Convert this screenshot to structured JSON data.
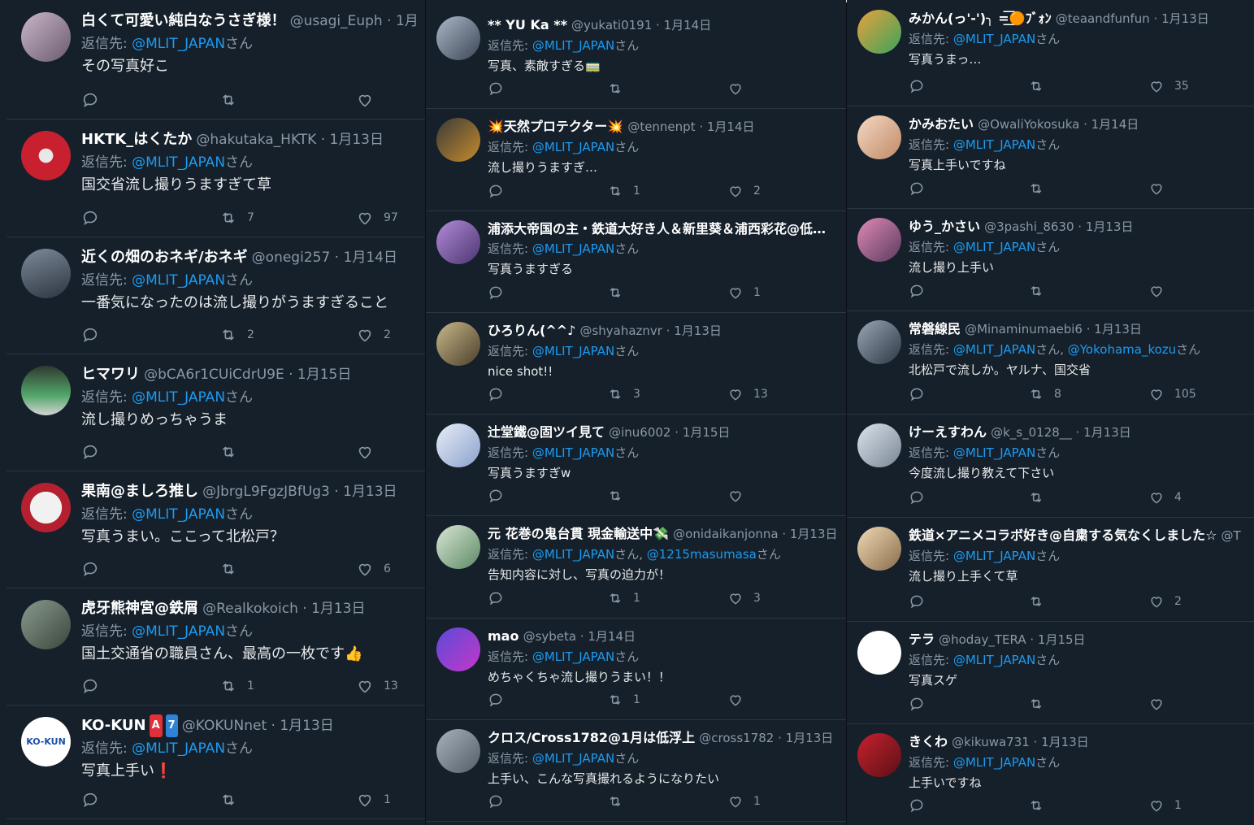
{
  "reply_prefix": "返信先: ",
  "san": "さん",
  "dot": " · ",
  "colors": {
    "background": "#15202b",
    "accent": "#1d9bf0",
    "muted": "#8b98a5",
    "divider": "#2b3640"
  },
  "columns": [
    {
      "tweets": [
        {
          "name": "白くて可愛い純白なうさぎ様！",
          "handle": "@usagi_Euph",
          "date": "1月",
          "replying": [
            "@MLIT_JAPAN"
          ],
          "text": "その写真好こ",
          "retweets": "",
          "likes": ""
        },
        {
          "name": "HKTK_はくたか",
          "handle": "@hakutaka_HKTK",
          "date": "1月13日",
          "replying": [
            "@MLIT_JAPAN"
          ],
          "text": "国交省流し撮りうますぎて草",
          "retweets": "7",
          "likes": "97"
        },
        {
          "name": "近くの畑のおネギ/おネギ",
          "handle": "@onegi257",
          "date": "1月14日",
          "replying": [
            "@MLIT_JAPAN"
          ],
          "text": "一番気になったのは流し撮りがうますぎること",
          "retweets": "2",
          "likes": "2"
        },
        {
          "name": "ヒマワリ",
          "handle": "@bCA6r1CUiCdrU9E",
          "date": "1月15日",
          "replying": [
            "@MLIT_JAPAN"
          ],
          "text": "流し撮りめっちゃうま",
          "retweets": "",
          "likes": ""
        },
        {
          "name": "果南@ましろ推し",
          "handle": "@JbrgL9FgzJBfUg3",
          "date": "1月13日",
          "replying": [
            "@MLIT_JAPAN"
          ],
          "text": "写真うまい。ここって北松戸？",
          "retweets": "",
          "likes": "6"
        },
        {
          "name": "虎牙熊神宮@鉄屑",
          "handle": "@Realkokoich",
          "date": "1月13日",
          "replying": [
            "@MLIT_JAPAN"
          ],
          "text": "国土交通省の職員さん、最高の一枚です👍",
          "retweets": "1",
          "likes": "13"
        },
        {
          "name": "KO-KUN",
          "name_badges": [
            "A",
            "7"
          ],
          "handle": "@KOKUNnet",
          "date": "1月13日",
          "replying": [
            "@MLIT_JAPAN"
          ],
          "text": "写真上手い❗",
          "retweets": "",
          "likes": "1",
          "avatar_text": "KO-KUN"
        }
      ]
    },
    {
      "tweets": [
        {
          "name": "** YU Ka **",
          "handle": "@yukati0191",
          "date": "1月14日",
          "replying": [
            "@MLIT_JAPAN"
          ],
          "text": "写真、素敵すぎる🚃",
          "retweets": "",
          "likes": ""
        },
        {
          "name": "💥天然プロテクター💥",
          "handle": "@tennenpt",
          "date": "1月14日",
          "replying": [
            "@MLIT_JAPAN"
          ],
          "text": "流し撮りうますぎ…",
          "retweets": "1",
          "likes": "2"
        },
        {
          "name": "浦添大帝国の主・鉄道大好き人＆新里葵＆浦西彩花@低…",
          "handle": "",
          "date": "",
          "replying": [
            "@MLIT_JAPAN"
          ],
          "text": "写真うますぎる",
          "retweets": "",
          "likes": "1"
        },
        {
          "name": "ひろりん(^^♪",
          "handle": "@shyahaznvr",
          "date": "1月13日",
          "replying": [
            "@MLIT_JAPAN"
          ],
          "text": "nice shot!!",
          "retweets": "3",
          "likes": "13"
        },
        {
          "name": "辻堂鐵@固ツイ見て",
          "handle": "@inu6002",
          "date": "1月15日",
          "replying": [
            "@MLIT_JAPAN"
          ],
          "text": "写真うますぎw",
          "retweets": "",
          "likes": ""
        },
        {
          "name": "元 花巻の鬼台貫 現金輸送中💸",
          "handle": "@onidaikanjonna",
          "date": "1月13日",
          "replying": [
            "@MLIT_JAPAN",
            "@1215masumasa"
          ],
          "text": "告知内容に対し、写真の迫力が！",
          "retweets": "1",
          "likes": "3"
        },
        {
          "name": "mao",
          "handle": "@sybeta",
          "date": "1月14日",
          "replying": [
            "@MLIT_JAPAN"
          ],
          "text": "めちゃくちゃ流し撮りうまい！！",
          "retweets": "1",
          "likes": ""
        },
        {
          "name": "クロス/Cross1782@1月は低浮上",
          "handle": "@cross1782",
          "date": "1月13日",
          "replying": [
            "@MLIT_JAPAN"
          ],
          "text": "上手い、こんな写真撮れるようになりたい",
          "retweets": "",
          "likes": "1"
        }
      ]
    },
    {
      "tweets": [
        {
          "name": "みかん(っ'-')╮ =͟͟͞͞🟠ﾌﾞｫﾝ",
          "handle": "@teaandfunfun",
          "date": "1月13日",
          "replying": [
            "@MLIT_JAPAN"
          ],
          "text": "写真うまっ…",
          "retweets": "",
          "likes": "35"
        },
        {
          "name": "かみおたい",
          "handle": "@OwaliYokosuka",
          "date": "1月14日",
          "replying": [
            "@MLIT_JAPAN"
          ],
          "text": "写真上手いですね",
          "retweets": "",
          "likes": ""
        },
        {
          "name": "ゆう_かさい",
          "handle": "@3pashi_8630",
          "date": "1月13日",
          "replying": [
            "@MLIT_JAPAN"
          ],
          "text": "流し撮り上手い",
          "retweets": "",
          "likes": ""
        },
        {
          "name": "常磐線民",
          "handle": "@Minaminumaebi6",
          "date": "1月13日",
          "replying": [
            "@MLIT_JAPAN",
            "@Yokohama_kozu"
          ],
          "text": "北松戸で流しか。ヤルナ、国交省",
          "retweets": "8",
          "likes": "105"
        },
        {
          "name": "けーえすわん",
          "handle": "@k_s_0128__",
          "date": "1月13日",
          "replying": [
            "@MLIT_JAPAN"
          ],
          "text": "今度流し撮り教えて下さい",
          "retweets": "",
          "likes": "4"
        },
        {
          "name": "鉄道×アニメコラボ好き@自粛する気なくしました☆",
          "handle": "@T",
          "date": "",
          "replying": [
            "@MLIT_JAPAN"
          ],
          "text": "流し撮り上手くて草",
          "retweets": "",
          "likes": "2"
        },
        {
          "name": "テラ",
          "handle": "@hoday_TERA",
          "date": "1月15日",
          "replying": [
            "@MLIT_JAPAN"
          ],
          "text": "写真スゲ",
          "retweets": "",
          "likes": ""
        },
        {
          "name": "きくわ",
          "handle": "@kikuwa731",
          "date": "1月13日",
          "replying": [
            "@MLIT_JAPAN"
          ],
          "text": "上手いですね",
          "retweets": "",
          "likes": "1"
        }
      ]
    }
  ]
}
